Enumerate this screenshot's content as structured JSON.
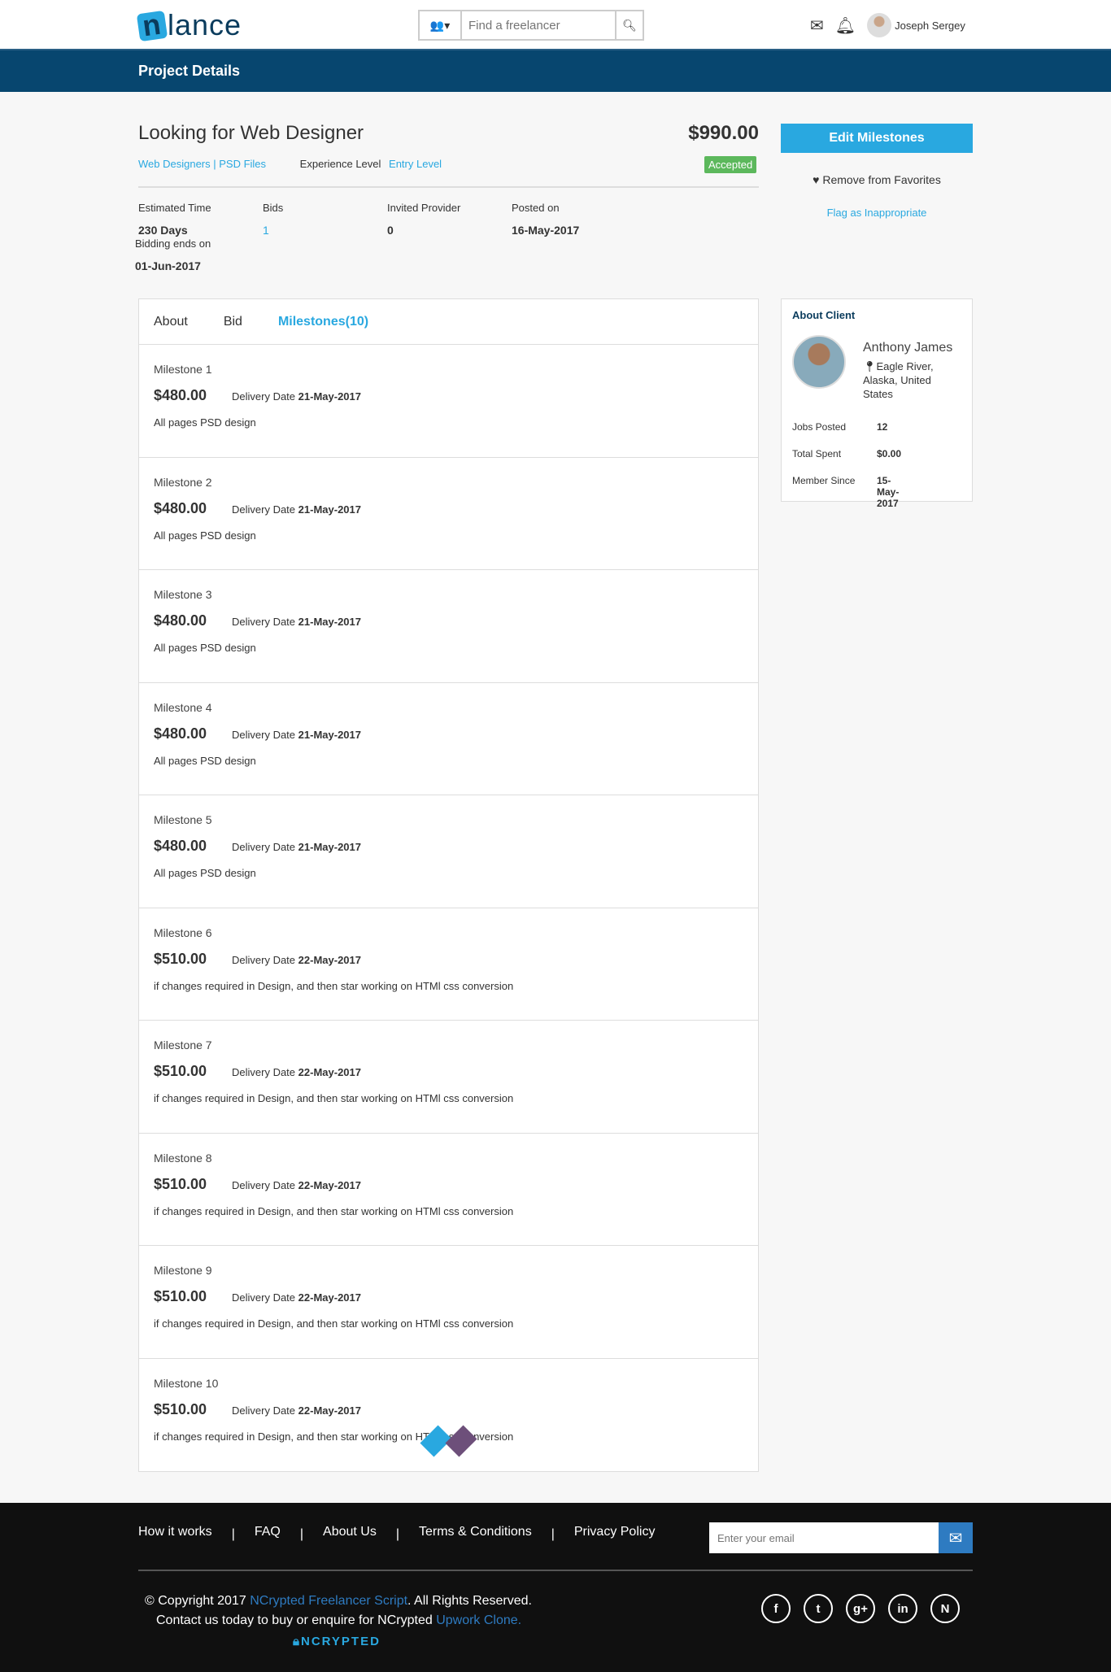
{
  "header": {
    "logo": "nlance",
    "search_placeholder": "Find a freelancer",
    "user_name": "Joseph Sergey"
  },
  "page_title": "Project Details",
  "project": {
    "title": "Looking for Web Designer",
    "price": "$990.00",
    "category1": "Web Designers",
    "category2": "PSD Files",
    "experience_label": "Experience Level",
    "experience_value": "Entry Level",
    "status": "Accepted",
    "meta": [
      {
        "label": "Estimated Time",
        "value": "230 Days"
      },
      {
        "label": "Bids",
        "value": "1"
      },
      {
        "label": "Invited Provider",
        "value": "0"
      },
      {
        "label": "Posted on",
        "value": "16-May-2017"
      }
    ],
    "bidding_label": "Bidding ends on",
    "bidding_value": "01-Jun-2017"
  },
  "actions": {
    "edit": "Edit Milestones",
    "favorite": "Remove from Favorites",
    "flag": "Flag as Inappropriate"
  },
  "tabs": [
    "About",
    "Bid",
    "Milestones(10)"
  ],
  "delivery_label": "Delivery Date",
  "milestones": [
    {
      "name": "Milestone 1",
      "amount": "$480.00",
      "date": "21-May-2017",
      "desc": "All pages PSD design"
    },
    {
      "name": "Milestone 2",
      "amount": "$480.00",
      "date": "21-May-2017",
      "desc": "All pages PSD design"
    },
    {
      "name": "Milestone 3",
      "amount": "$480.00",
      "date": "21-May-2017",
      "desc": "All pages PSD design"
    },
    {
      "name": "Milestone 4",
      "amount": "$480.00",
      "date": "21-May-2017",
      "desc": "All pages PSD design"
    },
    {
      "name": "Milestone 5",
      "amount": "$480.00",
      "date": "21-May-2017",
      "desc": "All pages PSD design"
    },
    {
      "name": "Milestone 6",
      "amount": "$510.00",
      "date": "22-May-2017",
      "desc": "if changes required in Design, and then star working on HTMl css conversion"
    },
    {
      "name": "Milestone 7",
      "amount": "$510.00",
      "date": "22-May-2017",
      "desc": "if changes required in Design, and then star working on HTMl css conversion"
    },
    {
      "name": "Milestone 8",
      "amount": "$510.00",
      "date": "22-May-2017",
      "desc": "if changes required in Design, and then star working on HTMl css conversion"
    },
    {
      "name": "Milestone 9",
      "amount": "$510.00",
      "date": "22-May-2017",
      "desc": "if changes required in Design, and then star working on HTMl css conversion"
    },
    {
      "name": "Milestone 10",
      "amount": "$510.00",
      "date": "22-May-2017",
      "desc": "if changes required in Design, and then star working on HTMl css conversion"
    }
  ],
  "client": {
    "heading": "About Client",
    "name": "Anthony James",
    "location": "Eagle River, Alaska, United States",
    "stats": [
      {
        "label": "Jobs Posted",
        "value": "12"
      },
      {
        "label": "Total Spent",
        "value": "$0.00"
      },
      {
        "label": "Member Since",
        "value": "15-May-2017"
      }
    ]
  },
  "footer": {
    "links": [
      "How it works",
      "FAQ",
      "About Us",
      "Terms & Conditions",
      "Privacy Policy"
    ],
    "separator": "|",
    "email_placeholder": "Enter your email",
    "copy_pre": "© Copyright 2017 ",
    "copy_link": "NCrypted Freelancer Script",
    "copy_post": ". All Rights Reserved.",
    "contact_pre": "Contact us today to buy or enquire for NCrypted ",
    "contact_link": "Upwork Clone.",
    "badge": "NCRYPTED",
    "social": [
      "facebook",
      "twitter",
      "google-plus",
      "linkedin",
      "ncrypted"
    ]
  },
  "colors": {
    "accent": "#29a8e0",
    "nav": "#07466f",
    "success": "#5cb85c",
    "footer": "#101010"
  }
}
